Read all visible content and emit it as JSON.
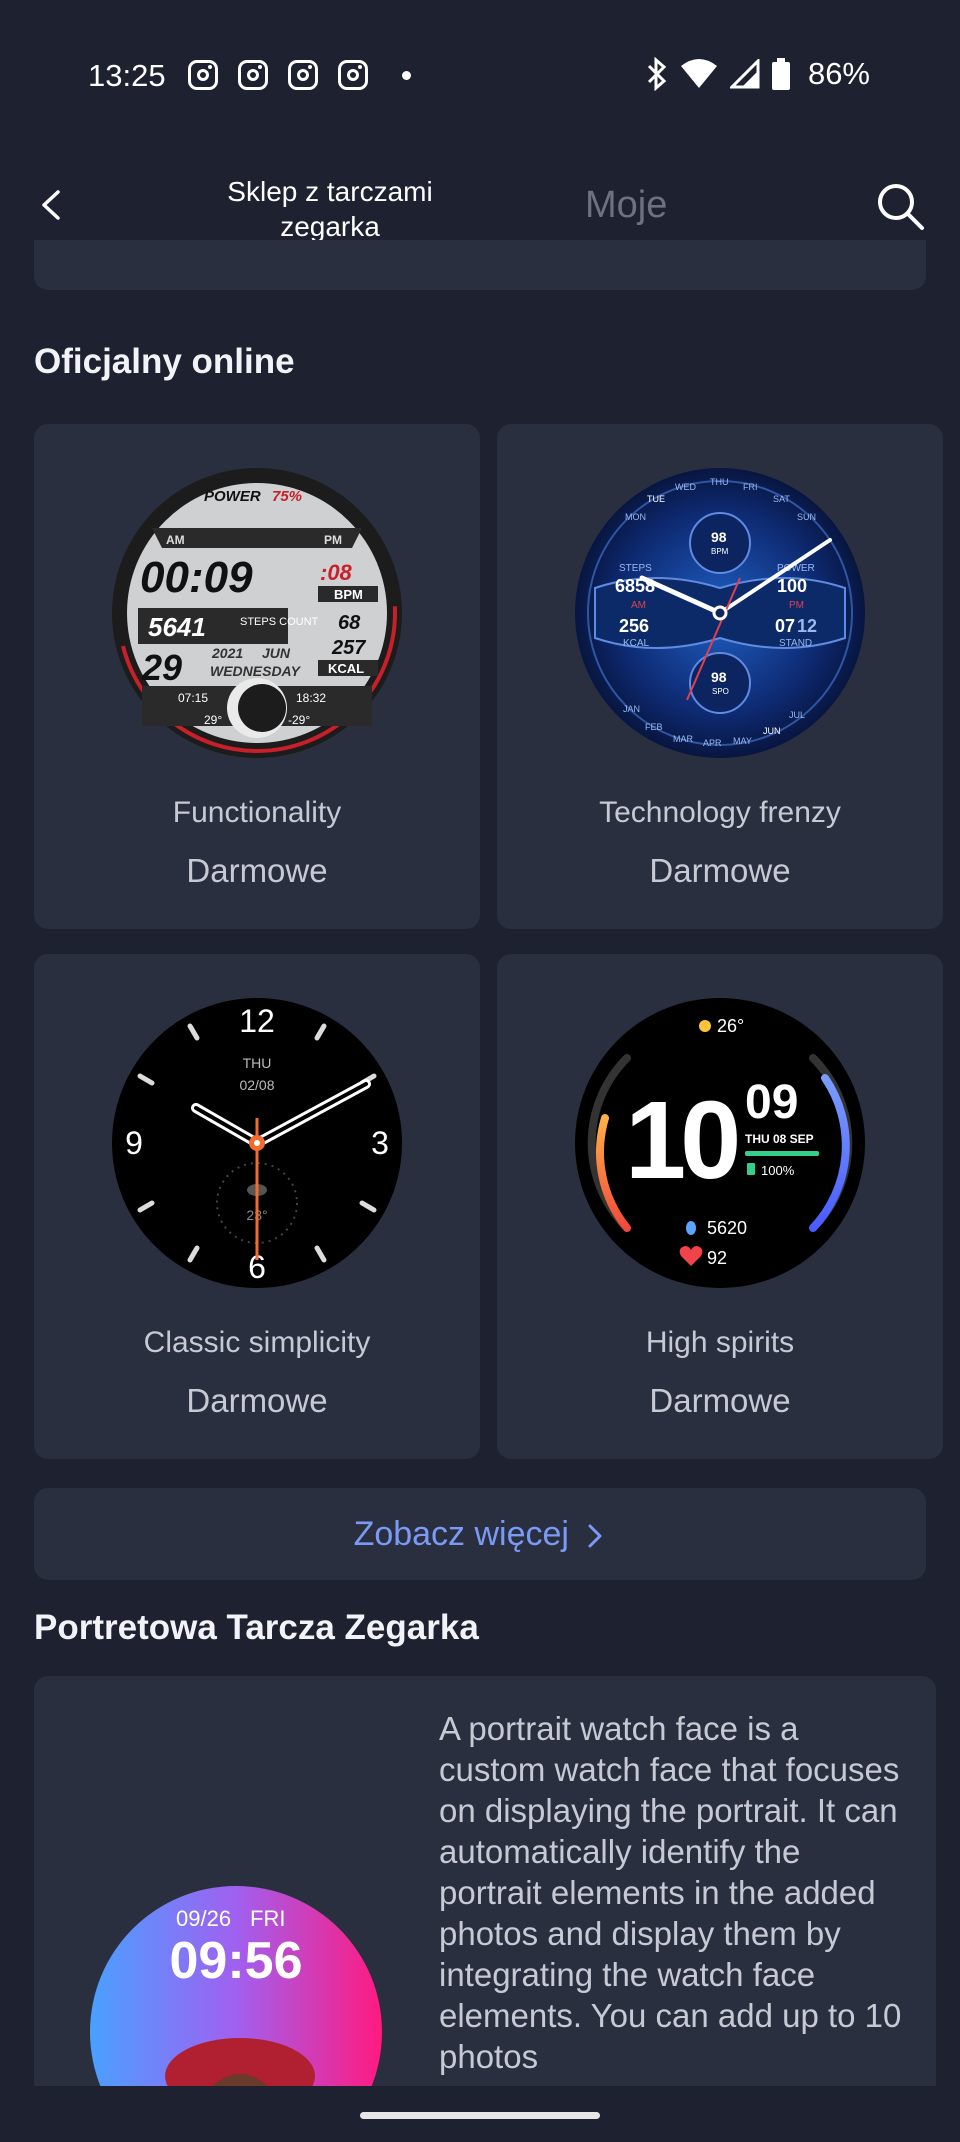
{
  "status_bar": {
    "time": "13:25",
    "battery": "86%",
    "icons": [
      "instagram-icon",
      "instagram-icon",
      "instagram-icon",
      "instagram-icon",
      "dot-icon",
      "bluetooth-icon",
      "wifi-icon",
      "signal-icon",
      "battery-icon"
    ]
  },
  "header": {
    "back_icon": "chevron-left-icon",
    "tab_shop": "Sklep z tarczami zegarka",
    "tab_mine": "Moje",
    "search_icon": "search-icon"
  },
  "sections": {
    "official": {
      "title": "Oficjalny online",
      "cards": [
        {
          "name": "Functionality",
          "price": "Darmowe"
        },
        {
          "name": "Technology frenzy",
          "price": "Darmowe"
        },
        {
          "name": "Classic simplicity",
          "price": "Darmowe"
        },
        {
          "name": "High spirits",
          "price": "Darmowe"
        }
      ],
      "see_more": "Zobacz więcej"
    },
    "portrait": {
      "title": "Portretowa Tarcza Zegarka",
      "description": "A portrait watch face is a custom watch face that focuses on displaying the portrait. It can automatically identify the portrait elements in the added photos and display them by integrating the watch face elements. You can add up to 10 photos"
    }
  },
  "faces": {
    "functionality": {
      "power": "POWER",
      "power_pct": "75%",
      "am": "AM",
      "pm": "PM",
      "time": "00:09",
      "seconds": ":08",
      "bpm_label": "BPM",
      "steps": "5641",
      "steps_label": "STEPS COUNT",
      "bpm": "68",
      "kcal": "257",
      "kcal_label": "KCAL",
      "day": "29",
      "year": "2021",
      "month": "JUN",
      "weekday": "WEDNESDAY",
      "sunrise": "07:15",
      "sunset": "18:32",
      "temp_high": "29°",
      "temp_low": "-29°"
    },
    "technology": {
      "days": [
        "MON",
        "TUE",
        "WED",
        "THU",
        "FRI",
        "SAT",
        "SUN"
      ],
      "months": [
        "JAN",
        "FEB",
        "MAR",
        "APR",
        "MAY",
        "JUN",
        "JUL"
      ],
      "bpm": "98",
      "bpm_label": "BPM",
      "steps_label": "STEPS",
      "steps": "6858",
      "am": "AM",
      "power_label": "POWER",
      "power": "100",
      "pm": "PM",
      "kcal": "256",
      "kcal_label": "KCAL",
      "stand_a": "07",
      "stand_b": "12",
      "stand_label": "STAND",
      "spo": "98",
      "spo_label": "SPO"
    },
    "classic": {
      "n12": "12",
      "n3": "3",
      "n6": "6",
      "n9": "9",
      "day": "THU",
      "date": "02/08",
      "temp": "23°"
    },
    "spirits": {
      "weather": "26°",
      "hour": "10",
      "minute": "09",
      "date": "THU 08 SEP",
      "battery": "100%",
      "battery_level": 1.0,
      "steps": "5620",
      "heart": "92"
    },
    "portrait": {
      "date": "09/26",
      "day": "FRI",
      "time": "09:56"
    }
  }
}
